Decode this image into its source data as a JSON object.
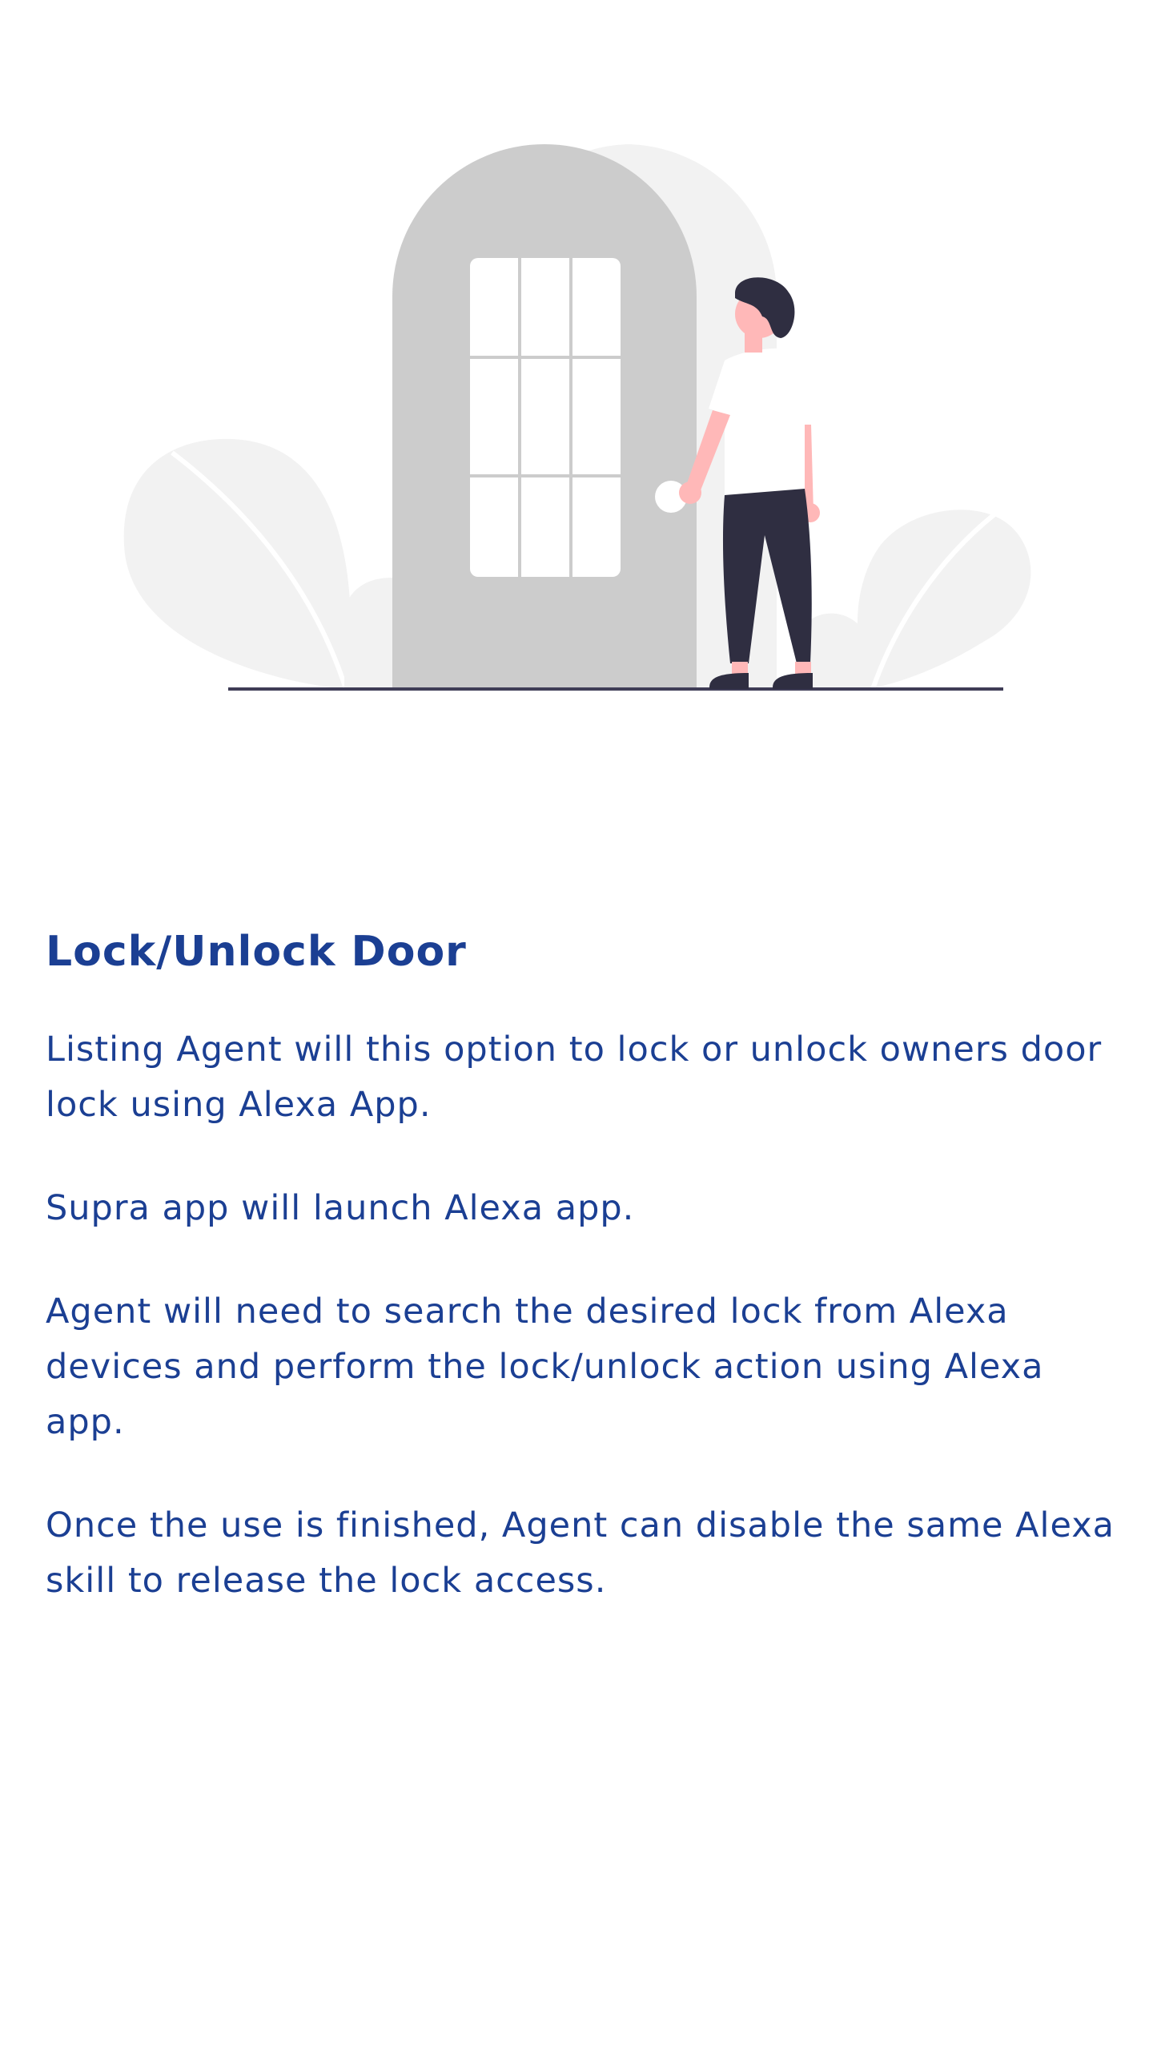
{
  "illustration": {
    "icon": "door-person-illustration"
  },
  "main": {
    "title": "Lock/Unlock Door",
    "paragraphs": [
      "Listing Agent will this option to lock or unlock owners door lock using Alexa App.",
      "Supra app will launch Alexa app.",
      "Agent will need to search the desired lock from Alexa devices and perform the lock/unlock action using Alexa app.",
      "Once the use is finished, Agent can disable the same Alexa skill to release the lock access."
    ]
  },
  "colors": {
    "text": "#1b3f93",
    "door": "#cccccc",
    "foliage": "#f2f2f2",
    "skin": "#ffb8b8",
    "dark": "#2f2e41"
  }
}
